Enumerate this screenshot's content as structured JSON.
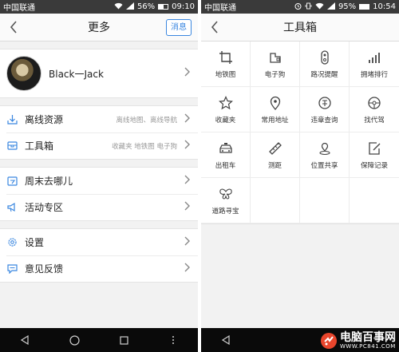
{
  "left": {
    "statusbar": {
      "carrier": "中国联通",
      "battery": "56%",
      "battery_level": 0.56,
      "time": "09:10"
    },
    "appbar": {
      "title": "更多",
      "message_button": "消息"
    },
    "profile": {
      "name": "Black一Jack"
    },
    "groups": [
      [
        {
          "label": "离线资源",
          "hint": "离线地图、离线导航",
          "icon": "download-icon"
        },
        {
          "label": "工具箱",
          "hint": "收藏夹 地铁图 电子狗",
          "icon": "toolbox-icon"
        }
      ],
      [
        {
          "label": "周末去哪儿",
          "hint": "",
          "icon": "calendar-icon"
        },
        {
          "label": "活动专区",
          "hint": "",
          "icon": "megaphone-icon"
        }
      ],
      [
        {
          "label": "设置",
          "hint": "",
          "icon": "gear-icon"
        },
        {
          "label": "意见反馈",
          "hint": "",
          "icon": "feedback-icon"
        }
      ]
    ]
  },
  "right": {
    "statusbar": {
      "carrier": "中国联通",
      "battery": "95%",
      "battery_level": 0.95,
      "time": "10:54"
    },
    "appbar": {
      "title": "工具箱"
    },
    "tools": [
      {
        "label": "地铁图",
        "icon": "crop-icon"
      },
      {
        "label": "电子狗",
        "icon": "camera-dog-icon"
      },
      {
        "label": "路况提醒",
        "icon": "traffic-light-icon"
      },
      {
        "label": "拥堵排行",
        "icon": "signal-bars-icon"
      },
      {
        "label": "收藏夹",
        "icon": "star-icon"
      },
      {
        "label": "常用地址",
        "icon": "location-pin-icon"
      },
      {
        "label": "违章查询",
        "icon": "violation-icon"
      },
      {
        "label": "找代驾",
        "icon": "steering-wheel-icon"
      },
      {
        "label": "出租车",
        "icon": "taxi-icon"
      },
      {
        "label": "测距",
        "icon": "ruler-icon"
      },
      {
        "label": "位置共享",
        "icon": "share-location-icon"
      },
      {
        "label": "保障记录",
        "icon": "shield-record-icon"
      },
      {
        "label": "道路寻宝",
        "icon": "butterfly-icon"
      }
    ]
  },
  "watermark": {
    "title": "电脑百事网",
    "url": "WWW.PC841.COM"
  }
}
